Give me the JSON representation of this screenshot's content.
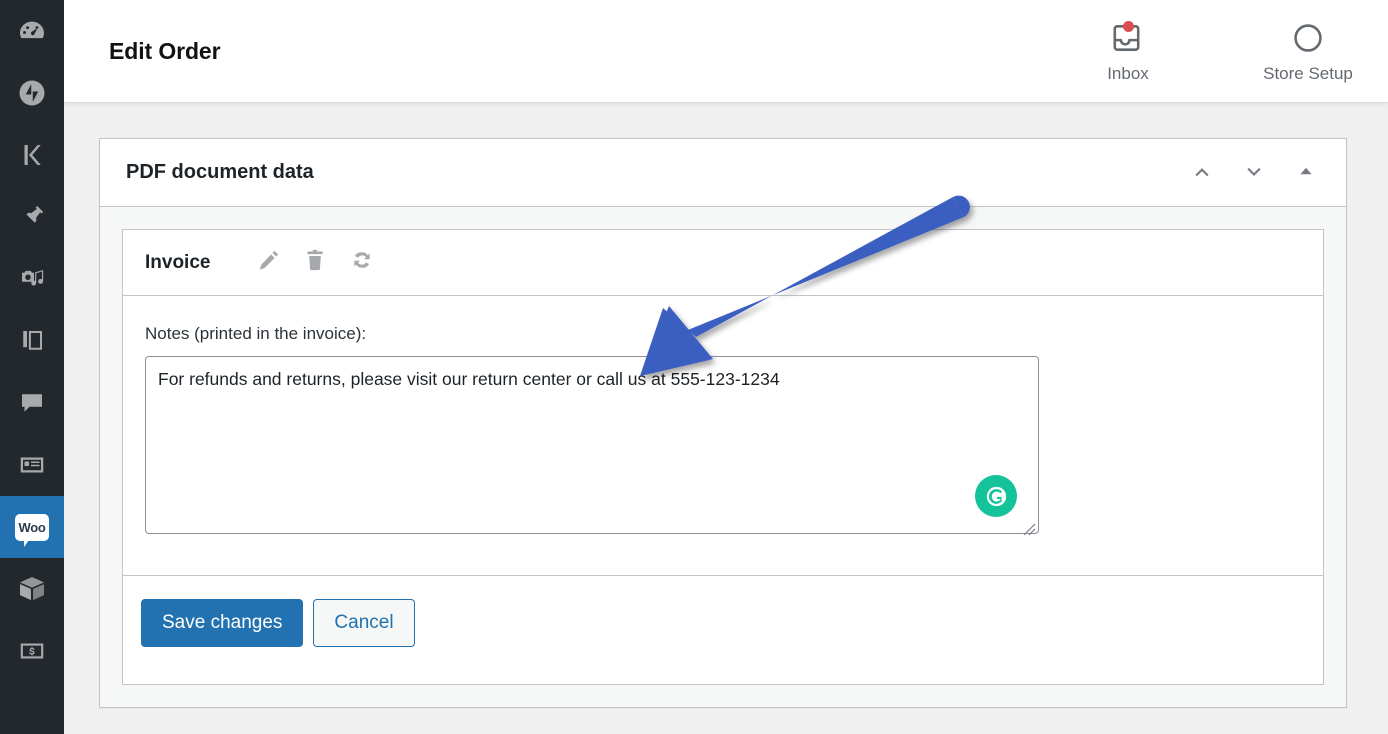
{
  "sidebar": {
    "items": [
      {
        "name": "dashboard",
        "icon": "dashboard-icon",
        "label": "Dashboard",
        "active": false
      },
      {
        "name": "jetpack",
        "icon": "jetpack-icon",
        "label": "Jetpack",
        "active": false
      },
      {
        "name": "kinsta",
        "icon": "kinsta-k-icon",
        "label": "Kinsta",
        "active": false
      },
      {
        "name": "posts",
        "icon": "pin-icon",
        "label": "Posts",
        "active": false
      },
      {
        "name": "media",
        "icon": "media-icon",
        "label": "Media",
        "active": false
      },
      {
        "name": "pages",
        "icon": "pages-icon",
        "label": "Pages",
        "active": false
      },
      {
        "name": "comments",
        "icon": "comment-bubble-icon",
        "label": "Comments",
        "active": false
      },
      {
        "name": "forms",
        "icon": "form-card-icon",
        "label": "Forms",
        "active": false
      },
      {
        "name": "woocommerce",
        "icon": "woo-logo-icon",
        "label": "Woo",
        "active": true
      },
      {
        "name": "products",
        "icon": "product-box-icon",
        "label": "Products",
        "active": false
      },
      {
        "name": "payments",
        "icon": "dollar-bill-icon",
        "label": "Payments",
        "active": false
      }
    ]
  },
  "header": {
    "title": "Edit Order",
    "actions": [
      {
        "name": "inbox",
        "label": "Inbox",
        "icon": "inbox-icon",
        "has_badge": true,
        "badge_color": "#d94f4f"
      },
      {
        "name": "store-setup",
        "label": "Store Setup",
        "icon": "circle-progress-icon",
        "has_badge": false
      }
    ]
  },
  "postbox": {
    "title": "PDF document data",
    "handles": [
      {
        "name": "move-up",
        "icon": "chevron-up-icon"
      },
      {
        "name": "move-down",
        "icon": "chevron-down-icon"
      },
      {
        "name": "toggle-panel",
        "icon": "triangle-up-icon"
      }
    ]
  },
  "document": {
    "name": "Invoice",
    "actions": [
      {
        "name": "edit-document",
        "icon": "pencil-icon"
      },
      {
        "name": "delete-document",
        "icon": "trash-icon"
      },
      {
        "name": "regenerate-document",
        "icon": "refresh-icon"
      }
    ],
    "notes_label": "Notes (printed in the invoice):",
    "notes_value": "For refunds and returns, please visit our return center or call us at 555-123-1234",
    "notes_placeholder": "",
    "grammarly_glyph": "G",
    "buttons": {
      "save": "Save changes",
      "cancel": "Cancel"
    }
  },
  "annotation": {
    "arrow_color": "#3b5fc0",
    "type": "pointer-arrow"
  }
}
